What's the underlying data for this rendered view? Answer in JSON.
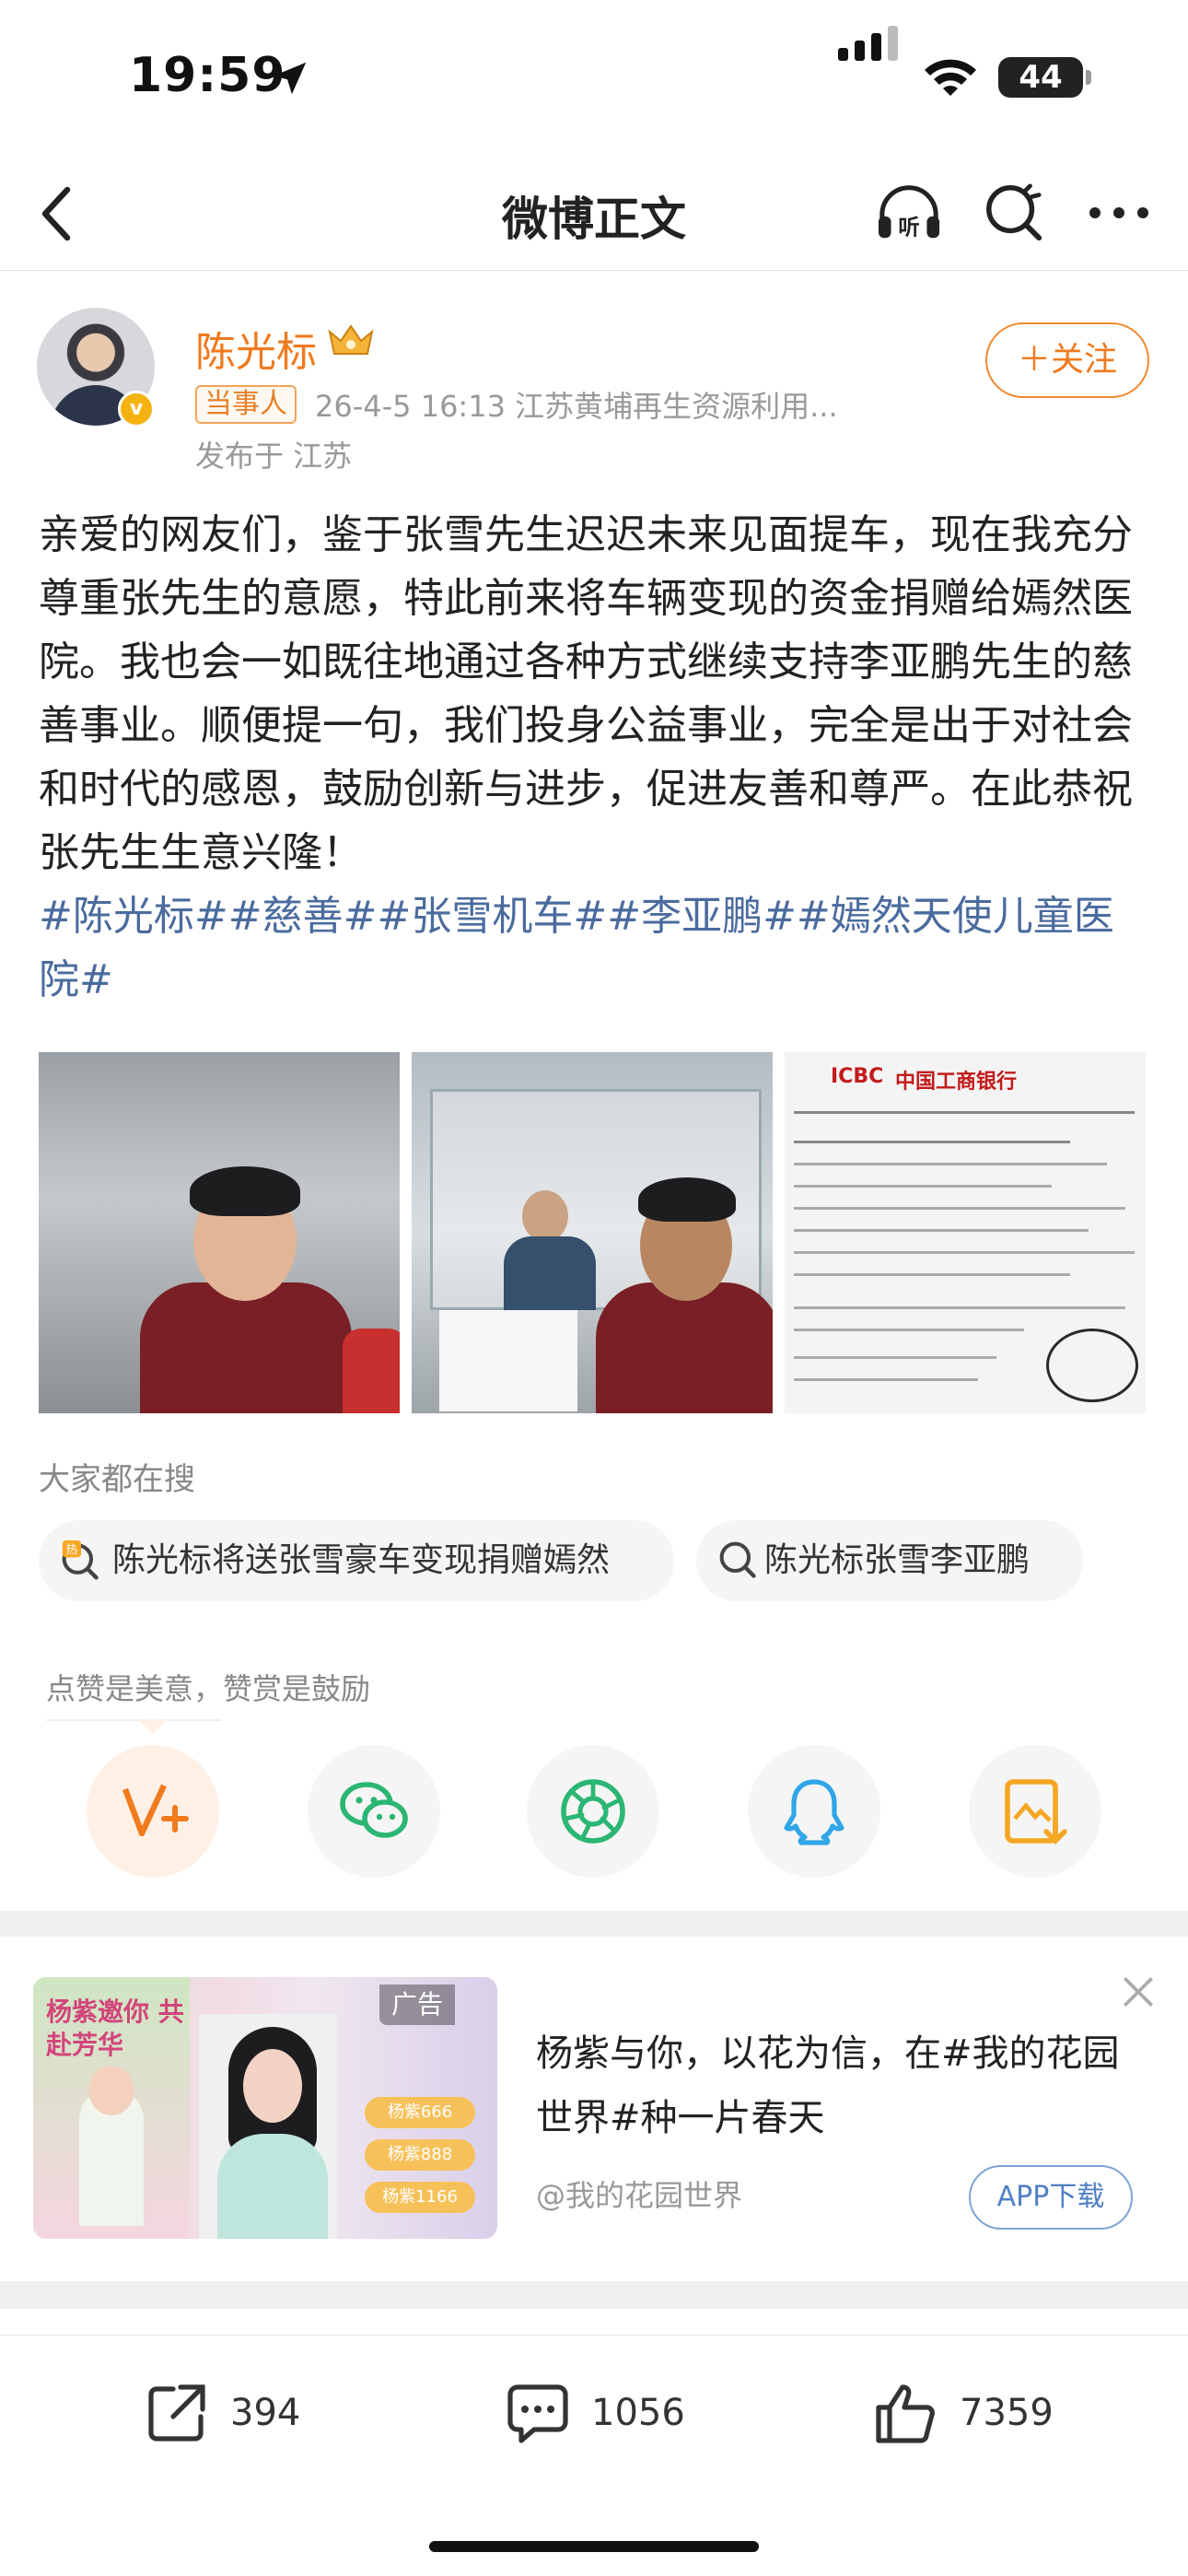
{
  "status_bar": {
    "time": "19:59",
    "battery": "44"
  },
  "nav": {
    "title": "微博正文"
  },
  "author": {
    "name": "陈光标",
    "badge": "当事人",
    "meta": "26-4-5 16:13  江苏黄埔再生资源利用...",
    "location": "发布于 江苏",
    "follow_label": "＋关注",
    "verified_glyph": "v"
  },
  "post": {
    "text": "亲爱的网友们，鉴于张雪先生迟迟未来见面提车，现在我充分尊重张先生的意愿，特此前来将车辆变现的资金捐赠给嫣然医院。我也会一如既往地通过各种方式继续支持李亚鹏先生的慈善事业。顺便提一句，我们投身公益事业，完全是出于对社会和时代的感恩，鼓励创新与进步，促进友善和尊严。在此恭祝张先生生意兴隆！",
    "tags": "#陈光标##慈善##张雪机车##李亚鹏##嫣然天使儿童医院#"
  },
  "photos": {
    "receipt_bank_name": "中国工商银行",
    "receipt_bank_code": "ICBC"
  },
  "hot_search": {
    "label": "大家都在搜",
    "chips": [
      {
        "text": "陈光标将送张雪豪车变现捐赠嫣然",
        "icon": "hot-search-icon"
      },
      {
        "text": "陈光标张雪李亚鹏",
        "icon": "search-icon"
      }
    ]
  },
  "reward": {
    "label": "点赞是美意，赞赏是鼓励",
    "share_targets": [
      "reward-v-plus",
      "wechat",
      "wechat-moments",
      "qq",
      "save-image"
    ]
  },
  "ad": {
    "badge": "广告",
    "text": "杨紫与你，以花为信，在#我的花园世界#种一片春天",
    "source": "@我的花园世界",
    "download_label": "APP下载",
    "image_title": "杨紫邀你 共赴芳华",
    "image_buttons": [
      "杨紫666",
      "杨紫888",
      "杨紫1166"
    ]
  },
  "bottom_bar": {
    "repost_count": "394",
    "comment_count": "1056",
    "like_count": "7359"
  },
  "colors": {
    "accent": "#f07a1e",
    "link": "#4b6b9e",
    "ad_button": "#4f7fc5"
  }
}
